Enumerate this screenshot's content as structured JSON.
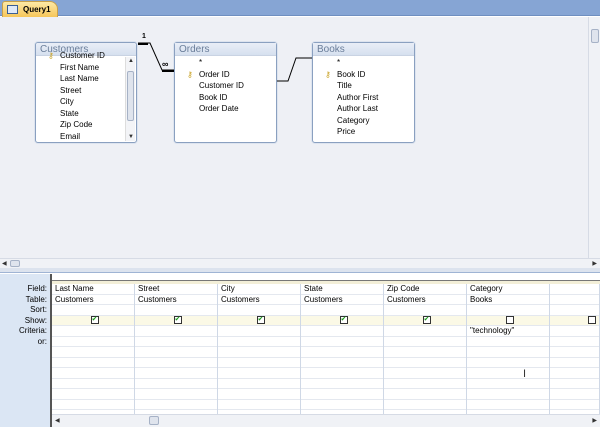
{
  "tab": {
    "label": "Query1"
  },
  "tables": [
    {
      "name": "Customers",
      "fields": [
        "Customer ID",
        "First Name",
        "Last Name",
        "Street",
        "City",
        "State",
        "Zip Code",
        "Email"
      ],
      "key": "Customer ID"
    },
    {
      "name": "Orders",
      "fields": [
        "*",
        "Order ID",
        "Customer ID",
        "Book ID",
        "Order Date"
      ],
      "key": "Order ID"
    },
    {
      "name": "Books",
      "fields": [
        "*",
        "Book ID",
        "Title",
        "Author First",
        "Author Last",
        "Category",
        "Price"
      ],
      "key": "Book ID"
    }
  ],
  "relationship": {
    "one": "1",
    "many": "∞"
  },
  "row_labels": [
    "Field:",
    "Table:",
    "Sort:",
    "Show:",
    "Criteria:",
    "or:"
  ],
  "columns": [
    {
      "field": "Last Name",
      "table": "Customers",
      "show": true,
      "criteria": ""
    },
    {
      "field": "Street",
      "table": "Customers",
      "show": true,
      "criteria": ""
    },
    {
      "field": "City",
      "table": "Customers",
      "show": true,
      "criteria": ""
    },
    {
      "field": "State",
      "table": "Customers",
      "show": true,
      "criteria": ""
    },
    {
      "field": "Zip Code",
      "table": "Customers",
      "show": true,
      "criteria": ""
    },
    {
      "field": "Category",
      "table": "Books",
      "show": false,
      "criteria": "\"technology\""
    },
    {
      "field": "",
      "table": "",
      "show": false,
      "criteria": ""
    }
  ]
}
